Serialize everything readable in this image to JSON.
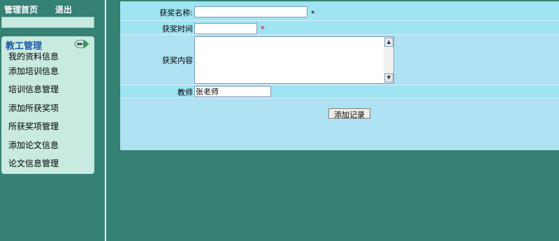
{
  "topnav": {
    "home": "管理首页",
    "logout": "退出"
  },
  "menu": {
    "title": "教工管理",
    "icon": "expand-arrow-icon",
    "items": [
      "我的资料信息",
      "添加培训信息",
      "培训信息管理",
      "添加所获奖项",
      "所获奖项管理",
      "添加论文信息",
      "论文信息管理"
    ]
  },
  "form": {
    "award_name": {
      "label": "获奖名称:",
      "value": "",
      "required_mark": "*"
    },
    "award_time": {
      "label": "获奖时间",
      "value": "",
      "required_mark": "*"
    },
    "award_content": {
      "label": "获奖内容",
      "value": ""
    },
    "teacher": {
      "label": "教师",
      "value": "张老师"
    },
    "submit_label": "添加记录"
  },
  "colors": {
    "page_bg": "#358174",
    "form_bg": "#aee1f1",
    "form_row_bg": "#9fe4f2",
    "menu_bg": "#c8eae0",
    "menu_title": "#1a59a8",
    "required_mark": "#cc0000"
  }
}
